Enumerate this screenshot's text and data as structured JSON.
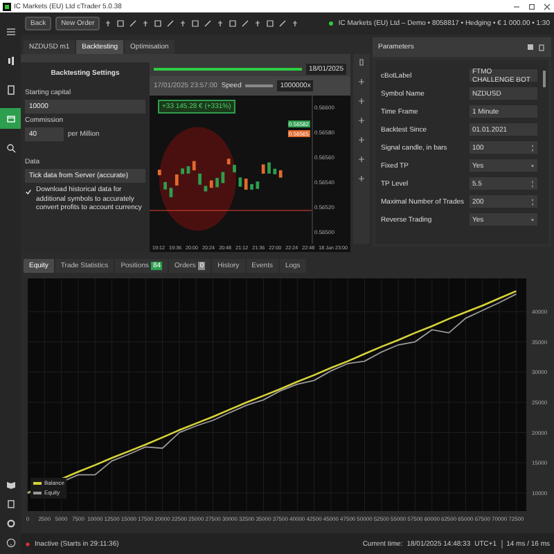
{
  "window": {
    "title": "IC Markets (EU) Ltd cTrader 5.0.38"
  },
  "sidebar": {
    "items": [
      {
        "selected": false
      },
      {
        "selected": false
      },
      {
        "selected": false
      },
      {
        "selected": true
      },
      {
        "selected": false
      }
    ]
  },
  "toolbar": {
    "buttons": [
      "Back",
      "New Order"
    ],
    "account": "IC Markets (EU) Ltd – Demo • 8058817 • Hedging • € 1 000.00 • 1:30"
  },
  "chart_tabs": [
    {
      "label": "NZDUSD  m1",
      "selected": false
    },
    {
      "label": "Backtesting",
      "selected": true
    },
    {
      "label": "Optimisation",
      "selected": false
    }
  ],
  "backtesting_settings": {
    "title": "Backtesting Settings",
    "starting_capital": {
      "label": "Starting capital",
      "value": "10000"
    },
    "commission": {
      "label": "Commission",
      "value": "40",
      "unit": "per Million"
    },
    "data": {
      "label": "Data",
      "value": "Tick data from Server (accurate)"
    },
    "download_option": {
      "label": "Download historical data for additional symbols to accurately convert profits to account currency",
      "checked": true
    }
  },
  "backtest_chart": {
    "end_date": "18/01/2025",
    "range_slider": {
      "level": 1
    },
    "current_time": "17/01/2025 23:57:00",
    "speed_label": "Speed",
    "speed_slider": {
      "level": 1
    },
    "speed": "1000000x",
    "profit": "+33 145.28 € (+331%)",
    "price_labels": [
      "0.56600",
      "0.56580",
      "0.56560",
      "0.56540",
      "0.56520",
      "0.56500"
    ],
    "bid": "0.56582",
    "ask": "0.56565",
    "time_labels": [
      "19:12",
      "19:36",
      "20:00",
      "20:24",
      "20:48",
      "21:12",
      "21:36",
      "22:00",
      "22:24",
      "22:48",
      "18 Jan 23:00"
    ]
  },
  "parameters": {
    "title": "Parameters",
    "rows": [
      {
        "label": "cBotLabel",
        "value": "FTMO CHALLENGE BOT",
        "kind": "text"
      },
      {
        "label": "Symbol Name",
        "value": "NZDUSD",
        "kind": "text"
      },
      {
        "label": "Time Frame",
        "value": "1 Minute",
        "kind": "text"
      },
      {
        "label": "Backtest Since",
        "value": "01.01.2021",
        "kind": "text"
      },
      {
        "label": "Signal candle, in bars",
        "value": "100",
        "kind": "number"
      },
      {
        "label": "Fixed TP",
        "value": "Yes",
        "kind": "select"
      },
      {
        "label": "TP Level",
        "value": "5.5",
        "kind": "number"
      },
      {
        "label": "Maximal Number of Trades",
        "value": "200",
        "kind": "number"
      },
      {
        "label": "Reverse Trading",
        "value": "Yes",
        "kind": "select"
      }
    ]
  },
  "bottom_tabs": [
    {
      "label": "Equity",
      "selected": true
    },
    {
      "label": "Trade Statistics",
      "selected": false
    },
    {
      "label": "Positions",
      "badge": "84",
      "color": "#2e9e4f",
      "selected": false
    },
    {
      "label": "Orders",
      "badge": "0",
      "color": "#8a8a8a",
      "selected": false
    },
    {
      "label": "History",
      "selected": false
    },
    {
      "label": "Events",
      "selected": false
    },
    {
      "label": "Logs",
      "selected": false
    }
  ],
  "equity_chart": {
    "chart_data": {
      "type": "line",
      "x": [
        0,
        2500,
        5000,
        7500,
        10000,
        12500,
        15000,
        17500,
        20000,
        22500,
        25000,
        27500,
        30000,
        32500,
        35000,
        37500,
        40000,
        42500,
        45000,
        47500,
        50000,
        52500,
        55000,
        57500,
        60000,
        62500,
        65000,
        67500,
        70000,
        72500
      ],
      "grid": true,
      "legend": "lower left",
      "series": [
        {
          "name": "Balance",
          "color": "#d6d23a",
          "values": [
            10000,
            11200,
            12300,
            13500,
            14600,
            15800,
            16900,
            18000,
            19200,
            20400,
            21500,
            22600,
            23800,
            25000,
            26100,
            27200,
            28400,
            29500,
            30700,
            31800,
            33000,
            34200,
            35300,
            36500,
            37600,
            38800,
            39900,
            41000,
            42200,
            43400
          ]
        },
        {
          "name": "Equity",
          "color": "#9a9a9a",
          "values": [
            10000,
            10600,
            11800,
            13000,
            13000,
            15300,
            16400,
            17600,
            17400,
            20000,
            21100,
            22000,
            23300,
            24500,
            25400,
            26900,
            28000,
            28600,
            30200,
            31400,
            31800,
            33300,
            34500,
            35000,
            37000,
            36500,
            38900,
            40200,
            41500,
            42900
          ]
        }
      ],
      "xlim": [
        0,
        74000
      ],
      "ylim": [
        7000,
        45500
      ],
      "xticks": [
        0,
        2500,
        5000,
        7500,
        10000,
        12500,
        15000,
        17500,
        20000,
        22500,
        25000,
        27500,
        30000,
        32500,
        35000,
        37500,
        40000,
        42500,
        45000,
        47500,
        50000,
        52500,
        55000,
        57500,
        60000,
        62500,
        65000,
        67500,
        70000,
        72500
      ],
      "yticks": [
        10000,
        15000,
        20000,
        25000,
        30000,
        35000,
        40000
      ]
    }
  },
  "status_bar": {
    "state": "Inactive (Starts in 29:11:36)",
    "current_time_label": "Current time:",
    "current_time": "18/01/2025 14:48:33",
    "timezone": "UTC+1",
    "latency": "14 ms / 16 ms"
  }
}
